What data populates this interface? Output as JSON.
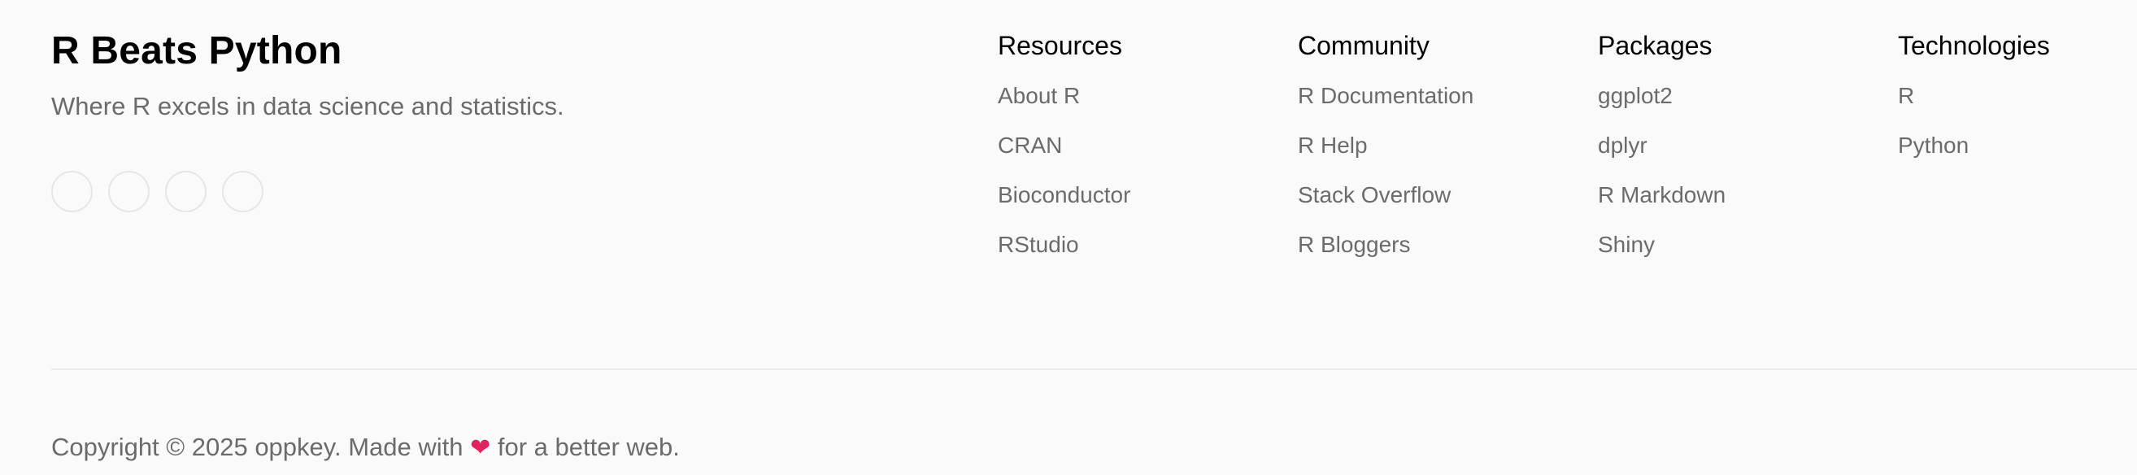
{
  "brand": {
    "title": "R Beats Python",
    "tagline": "Where R excels in data science and statistics."
  },
  "social_icons": [
    "social-icon",
    "social-icon",
    "social-icon",
    "social-icon"
  ],
  "columns": [
    {
      "heading": "Resources",
      "links": [
        "About R",
        "CRAN",
        "Bioconductor",
        "RStudio"
      ]
    },
    {
      "heading": "Community",
      "links": [
        "R Documentation",
        "R Help",
        "Stack Overflow",
        "R Bloggers"
      ]
    },
    {
      "heading": "Packages",
      "links": [
        "ggplot2",
        "dplyr",
        "R Markdown",
        "Shiny"
      ]
    },
    {
      "heading": "Technologies",
      "links": [
        "R",
        "Python"
      ]
    }
  ],
  "copyright": {
    "before": "Copyright © 2025 oppkey. Made with",
    "heart": "❤",
    "after": "for a better web."
  },
  "colors": {
    "background": "#fafafa",
    "heading": "#000000",
    "muted_text": "#6b6b6b",
    "divider": "#ececec",
    "heart": "#e0245e"
  }
}
